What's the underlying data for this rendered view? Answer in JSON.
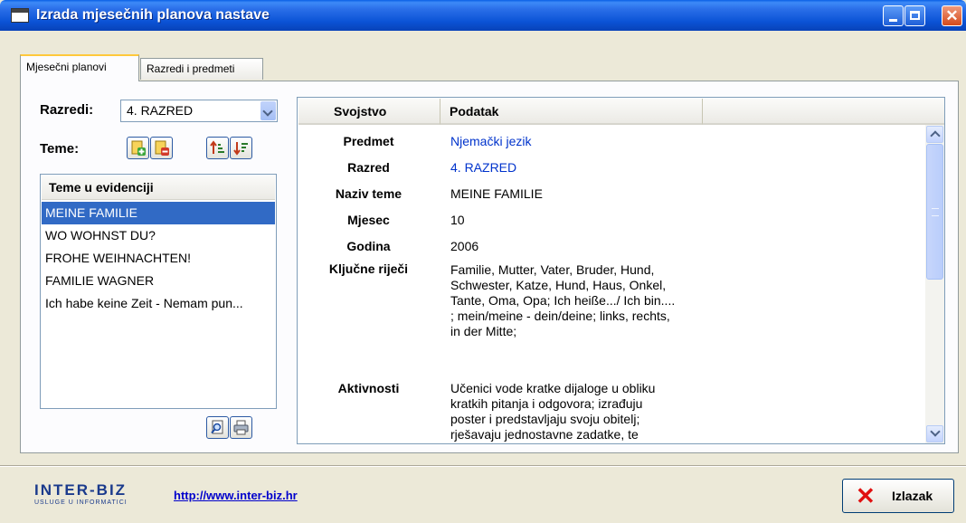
{
  "window": {
    "title": "Izrada mjesečnih planova nastave"
  },
  "tabs": [
    {
      "label": "Mjesečni planovi",
      "active": true
    },
    {
      "label": "Razredi i predmeti",
      "active": false
    }
  ],
  "left": {
    "razredi_label": "Razredi:",
    "razredi_value": "4. RAZRED",
    "teme_label": "Teme:",
    "toolbar": [
      "add-topic-icon",
      "delete-topic-icon",
      "sort-ascending-icon",
      "sort-descending-icon"
    ],
    "list_header": "Teme u evidenciji",
    "items": [
      "MEINE FAMILIE",
      "WO WOHNST DU?",
      "FROHE WEIHNACHTEN!",
      "FAMILIE WAGNER",
      "Ich habe keine Zeit - Nemam pun..."
    ],
    "selected_index": 0,
    "bottom_buttons": [
      "preview-icon",
      "print-icon"
    ]
  },
  "grid": {
    "col_property": "Svojstvo",
    "col_value": "Podatak",
    "rows": [
      {
        "name": "Predmet",
        "value": "Njemački jezik",
        "color": "#0033cc"
      },
      {
        "name": "Razred",
        "value": "4. RAZRED",
        "color": "#0033cc"
      },
      {
        "name": "Naziv teme",
        "value": "MEINE FAMILIE"
      },
      {
        "name": "Mjesec",
        "value": "10"
      },
      {
        "name": "Godina",
        "value": "2006"
      },
      {
        "name": "Ključne riječi",
        "lines": [
          "Familie, Mutter, Vater, Bruder, Hund,",
          "Schwester, Katze, Hund, Haus, Onkel,",
          "Tante, Oma, Opa; Ich heiße.../ Ich bin....",
          "; mein/meine - dein/deine; links, rechts,",
          "in der Mitte;"
        ]
      },
      {
        "name": "Aktivnosti",
        "lines": [
          "Učenici vode kratke dijaloge u obliku",
          "kratkih pitanja i odgovora; izrađuju",
          "poster i predstavljaju svoju obitelj;",
          "rješavaju jednostavne zadatke, te"
        ]
      }
    ]
  },
  "footer": {
    "logo_text": "INTER-BIZ",
    "logo_sub": "USLUGE U INFORMATICI",
    "link": "http://www.inter-biz.hr",
    "exit_label": "Izlazak"
  }
}
